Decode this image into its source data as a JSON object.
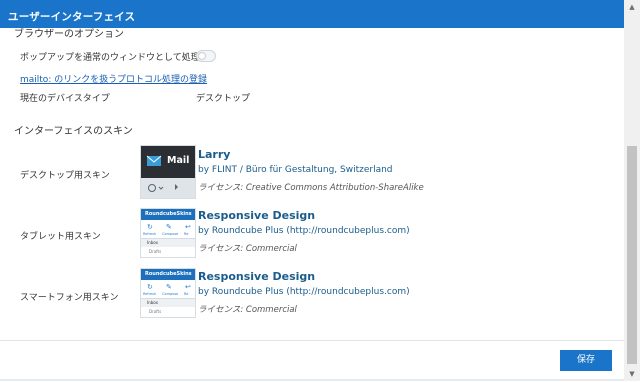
{
  "dialog": {
    "title": "ユーザーインターフェイス"
  },
  "browser_options": {
    "heading": "ブラウザーのオプション",
    "popup_label": "ポップアップを通常のウィンドウとして処理",
    "popup_enabled": false,
    "mailto_link": "mailto: のリンクを扱うプロトコル処理の登録",
    "device_type_label": "現在のデバイスタイプ",
    "device_type_value": "デスクトップ"
  },
  "skins": {
    "heading": "インターフェイスのスキン",
    "items": [
      {
        "label": "デスクトップ用スキン",
        "name": "Larry",
        "author": "by FLINT / Büro für Gestaltung, Switzerland",
        "license": "ライセンス: Creative Commons Attribution-ShareAlike",
        "thumb_text": "Mail"
      },
      {
        "label": "タブレット用スキン",
        "name": "Responsive Design",
        "author": "by Roundcube Plus (http://roundcubeplus.com)",
        "license": "ライセンス: Commercial",
        "thumb_text": "RoundcubeSkins",
        "thumb_items": [
          "Refresh",
          "Compose",
          "Re",
          "Inbox",
          "Drafts"
        ]
      },
      {
        "label": "スマートフォン用スキン",
        "name": "Responsive Design",
        "author": "by Roundcube Plus (http://roundcubeplus.com)",
        "license": "ライセンス: Commercial",
        "thumb_text": "RoundcubeSkins",
        "thumb_items": [
          "Refresh",
          "Compose",
          "Re",
          "Inbox",
          "Drafts"
        ]
      }
    ]
  },
  "footer": {
    "save_label": "保存"
  },
  "colors": {
    "accent": "#1a74c9",
    "link": "#1a5d8c"
  }
}
